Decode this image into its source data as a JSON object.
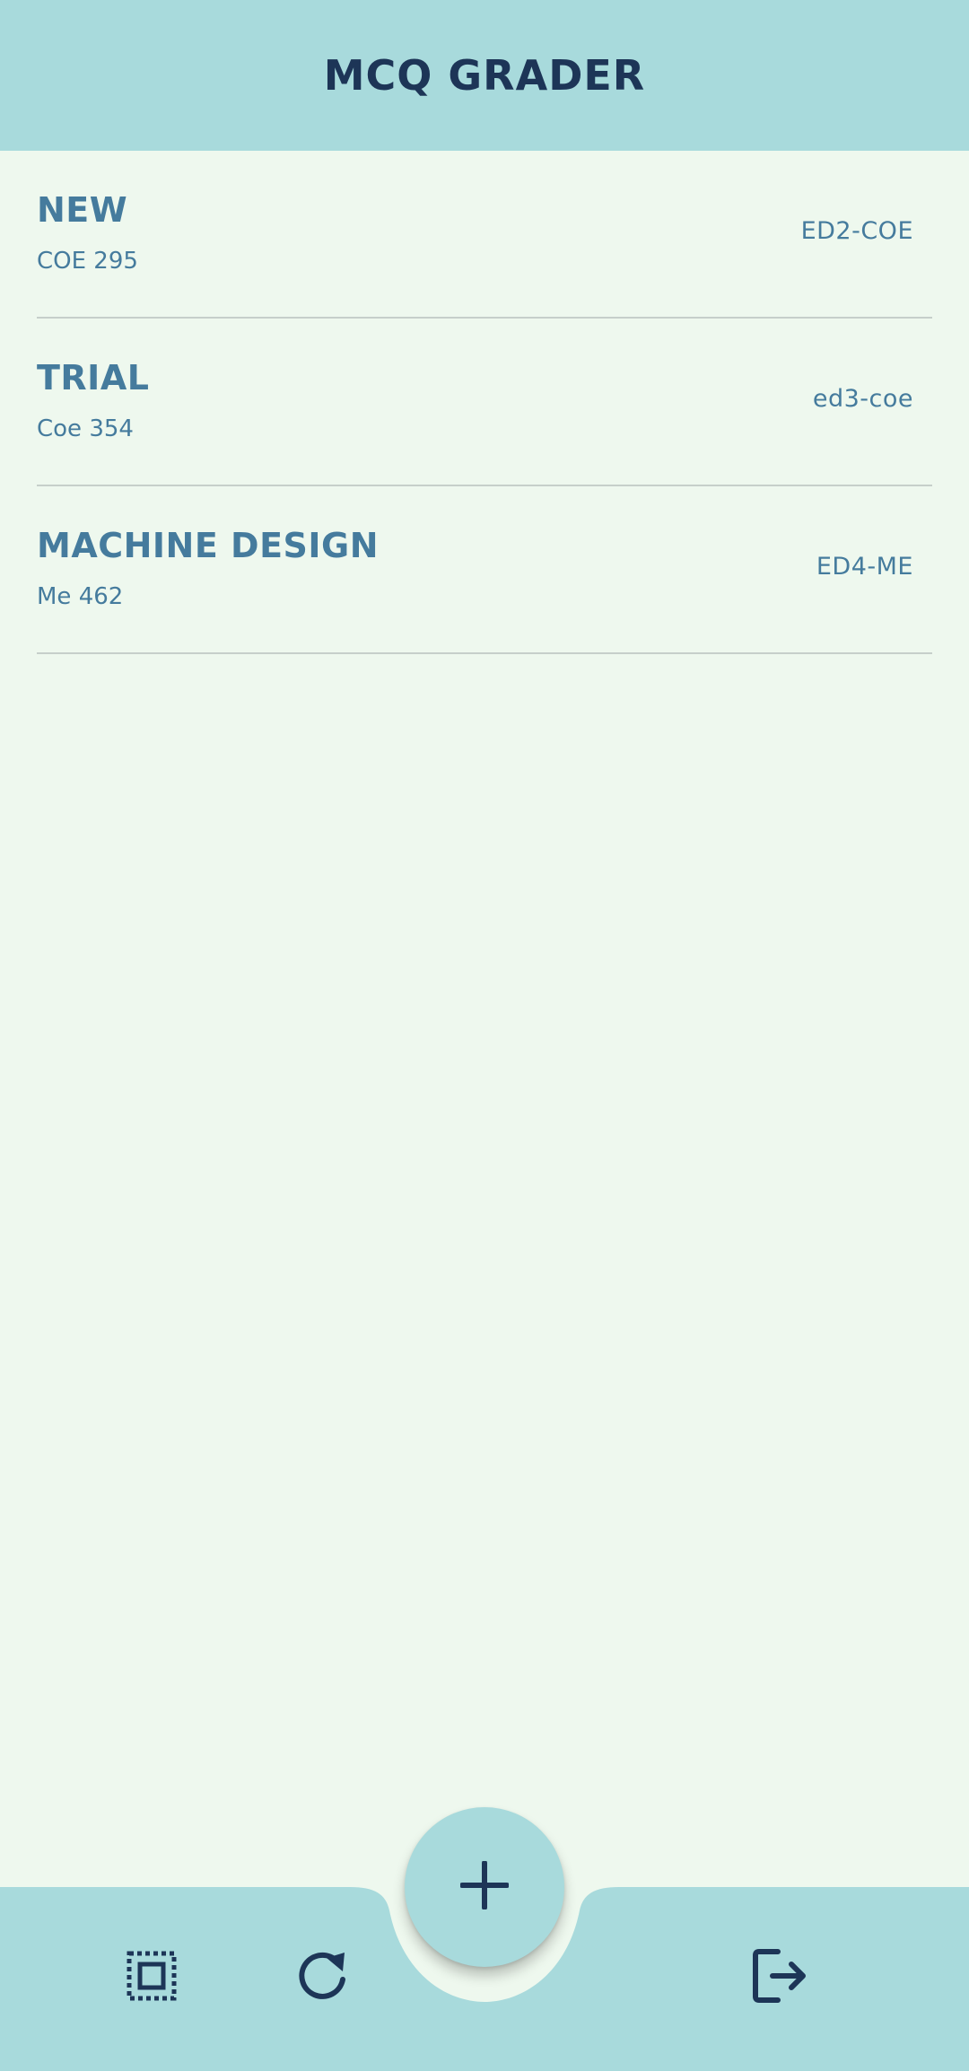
{
  "app_bar": {
    "title": "MCQ GRADER"
  },
  "exams": [
    {
      "title": "NEW",
      "code": "COE 295",
      "tag": "ED2-COE"
    },
    {
      "title": "TRIAL",
      "code": "Coe 354",
      "tag": "ed3-coe"
    },
    {
      "title": "MACHINE DESIGN",
      "code": "Me 462",
      "tag": "ED4-ME"
    }
  ],
  "bottom_nav": {
    "items": [
      {
        "icon": "select-all-icon"
      },
      {
        "icon": "refresh-icon"
      },
      {
        "icon": "logout-icon"
      }
    ],
    "fab_icon": "plus-icon"
  },
  "colors": {
    "app_bar": "#a8dadc",
    "background": "#eef8ee",
    "title_text": "#1d3557",
    "item_text": "#457b9d",
    "divider": "#c6cfca"
  }
}
